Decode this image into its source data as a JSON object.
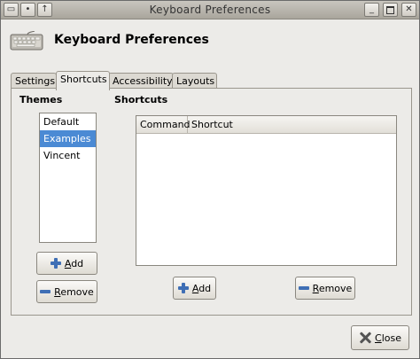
{
  "window": {
    "title": "Keyboard Preferences",
    "menu_glyph": "▭",
    "pin_glyph": "•",
    "up_glyph": "↑",
    "min_glyph": "_",
    "close_glyph": "✕"
  },
  "header": {
    "title": "Keyboard Preferences"
  },
  "tabs": [
    {
      "label": "Settings",
      "active": false
    },
    {
      "label": "Shortcuts",
      "active": true
    },
    {
      "label": "Accessibility",
      "active": false
    },
    {
      "label": "Layouts",
      "active": false
    }
  ],
  "themes": {
    "heading": "Themes",
    "items": [
      "Default",
      "Examples",
      "Vincent"
    ],
    "selected": "Examples",
    "add_prefix": "",
    "add_mnemonic": "A",
    "add_rest": "dd",
    "remove_mnemonic": "R",
    "remove_rest": "emove"
  },
  "shortcuts": {
    "heading": "Shortcuts",
    "columns": [
      "Command",
      "Shortcut"
    ],
    "rows": [],
    "add_mnemonic": "A",
    "add_rest": "dd",
    "remove_mnemonic": "R",
    "remove_rest": "emove"
  },
  "footer": {
    "close_mnemonic": "C",
    "close_rest": "lose"
  },
  "colors": {
    "selection": "#4b8ad4",
    "icon_blue": "#3f6fb5"
  }
}
